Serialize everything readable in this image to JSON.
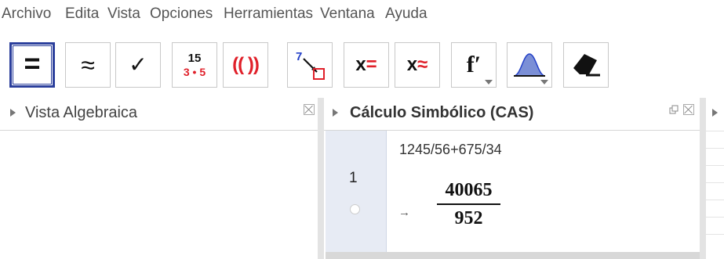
{
  "menu": [
    "Archivo",
    "Edita",
    "Vista",
    "Opciones",
    "Herramientas",
    "Ventana",
    "Ayuda"
  ],
  "toolbar": {
    "tools": [
      {
        "name": "evaluate-tool",
        "glyph": "=",
        "selected": true
      },
      {
        "name": "numeric-tool",
        "glyph": "≈"
      },
      {
        "name": "keep-input-tool",
        "glyph": "✓"
      },
      {
        "name": "factor-tool",
        "top": "15",
        "bottom": "3 • 5"
      },
      {
        "name": "expand-tool",
        "glyph": "(( ))"
      },
      {
        "name": "substitute-tool",
        "glyph": "7"
      },
      {
        "name": "solve-tool",
        "glyph": "x="
      },
      {
        "name": "solve-numerically-tool",
        "glyph": "x≈"
      },
      {
        "name": "derivative-tool",
        "glyph": "f′"
      },
      {
        "name": "probability-tool",
        "glyph": ""
      },
      {
        "name": "delete-tool",
        "glyph": ""
      }
    ]
  },
  "algebra_view": {
    "title": "Vista Algebraica"
  },
  "cas_view": {
    "title": "Cálculo Simbólico (CAS)",
    "rows": [
      {
        "number": "1",
        "input": "1245/56+675/34",
        "result_arrow": "→",
        "numerator": "40065",
        "denominator": "952"
      }
    ]
  },
  "colors": {
    "selected_border": "#2b3f9c",
    "red": "#e0202a",
    "blue_fill": "#7b8fd6"
  }
}
